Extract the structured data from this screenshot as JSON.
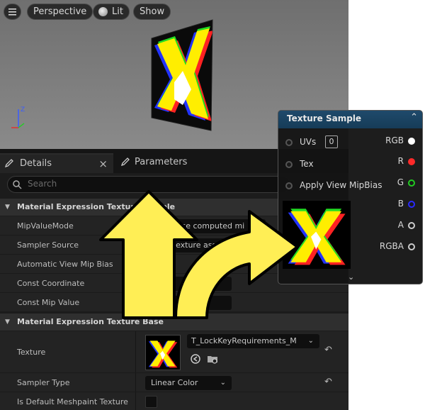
{
  "viewport": {
    "menu_icon": "hamburger-icon",
    "perspective_label": "Perspective",
    "lit_label": "Lit",
    "show_label": "Show",
    "axis_z": "Z"
  },
  "details": {
    "tab_details": "Details",
    "tab_parameters": "Parameters",
    "close_glyph": "×",
    "search_placeholder": "Search",
    "section1_title": "Material Expression Texture Sample",
    "mip_value_mode_label": "MipValueMode",
    "mip_value_mode_value": "None (use computed mi",
    "sampler_source_label": "Sampler Source",
    "sampler_source_value": "From texture asset",
    "auto_view_mip_bias_label": "Automatic View Mip Bias",
    "const_coordinate_label": "Const Coordinate",
    "const_mip_value_label": "Const Mip Value",
    "section2_title": "Material Expression Texture Base",
    "texture_label": "Texture",
    "texture_value": "T_LockKeyRequirements_M",
    "sampler_type_label": "Sampler Type",
    "sampler_type_value": "Linear Color",
    "is_default_meshpaint_label": "Is Default Meshpaint Texture",
    "reset_glyph": "↶",
    "dropdown_glyph": "⌄"
  },
  "node": {
    "title": "Texture Sample",
    "collapse_glyph": "⌃",
    "inputs": {
      "uvs": "UVs",
      "uvs_value": "0",
      "tex": "Tex",
      "apply_view_mip_bias": "Apply View MipBias"
    },
    "outputs": {
      "rgb": "RGB",
      "r": "R",
      "g": "G",
      "b": "B",
      "a": "A",
      "rgba": "RGBA"
    },
    "expand_glyph": "⌄"
  },
  "colors": {
    "r_pin": "#ff2a2a",
    "g_pin": "#22cc22",
    "b_pin": "#2222ff",
    "arrow_fill": "#ffee55",
    "node_header": "#1f4a6b"
  }
}
